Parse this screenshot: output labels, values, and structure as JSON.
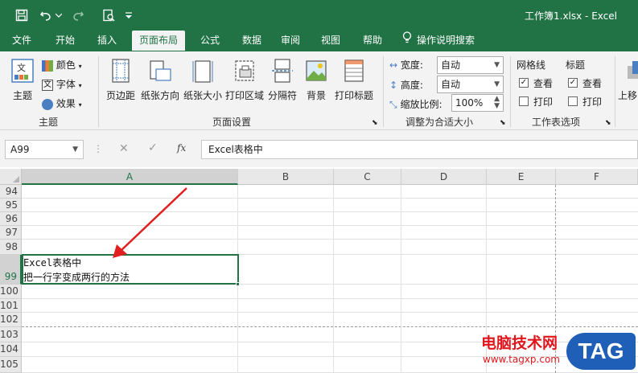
{
  "quick_access": {
    "icons": [
      "save-icon",
      "undo-icon",
      "redo-icon",
      "print-preview-icon",
      "customize-icon"
    ]
  },
  "window": {
    "title": "工作簿1.xlsx  -  Excel"
  },
  "tabs": [
    {
      "label": "文件"
    },
    {
      "label": "开始"
    },
    {
      "label": "插入"
    },
    {
      "label": "页面布局",
      "active": true
    },
    {
      "label": "公式"
    },
    {
      "label": "数据"
    },
    {
      "label": "审阅"
    },
    {
      "label": "视图"
    },
    {
      "label": "帮助"
    },
    {
      "label": "操作说明搜索"
    }
  ],
  "ribbon": {
    "theme_group": {
      "label": "主题",
      "theme_button": "主题",
      "colors": "颜色",
      "fonts": "字体",
      "effects": "效果"
    },
    "page_setup": {
      "label": "页面设置",
      "buttons": [
        "页边距",
        "纸张方向",
        "纸张大小",
        "打印区域",
        "分隔符",
        "背景",
        "打印标题"
      ]
    },
    "scale_to_fit": {
      "label": "调整为合适大小",
      "width_label": "宽度:",
      "width_value": "自动",
      "height_label": "高度:",
      "height_value": "自动",
      "scale_label": "缩放比例:",
      "scale_value": "100%"
    },
    "sheet_options": {
      "label": "工作表选项",
      "gridlines": {
        "title": "网格线",
        "view": "查看",
        "print": "打印",
        "view_checked": true,
        "print_checked": false
      },
      "headings": {
        "title": "标题",
        "view": "查看",
        "print": "打印",
        "view_checked": true,
        "print_checked": false
      }
    },
    "arrange": {
      "bring_forward": "上移"
    }
  },
  "formula_bar": {
    "name_box": "A99",
    "fx_label": "fx",
    "content": "Excel表格中"
  },
  "sheet": {
    "columns": [
      "A",
      "B",
      "C",
      "D",
      "E",
      "F"
    ],
    "rows": [
      "94",
      "95",
      "96",
      "97",
      "98",
      "99",
      "100",
      "101",
      "102",
      "103",
      "104",
      "105"
    ],
    "active_cell": "A99",
    "cell_a99_line1": "Excel表格中",
    "cell_a99_line2": "把一行字变成两行的方法"
  },
  "watermark": {
    "site_name": "电脑技术网",
    "url": "www.tagxp.com",
    "badge": "TAG"
  },
  "colors": {
    "excel_green": "#217346",
    "annotation_arrow": "#e02020",
    "watermark_red": "#e0161d",
    "tag_blue": "#1f5fb8"
  }
}
